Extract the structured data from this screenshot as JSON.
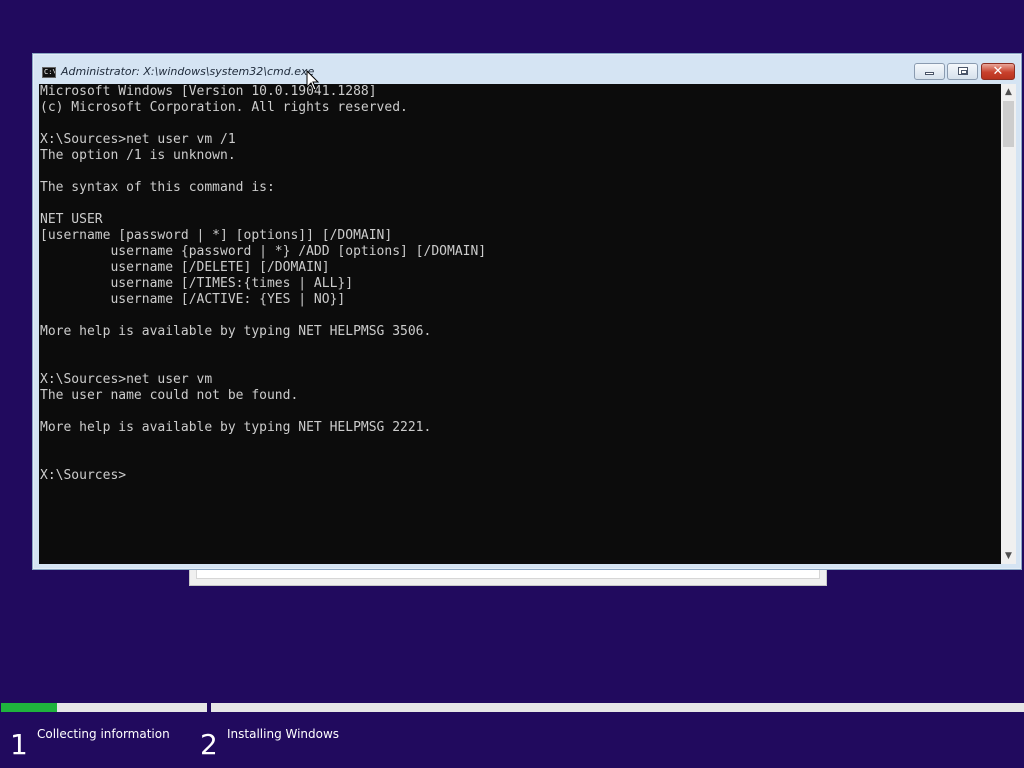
{
  "window": {
    "title": "Administrator: X:\\windows\\system32\\cmd.exe",
    "app_icon_text": "C:\\"
  },
  "console": {
    "lines": [
      "Microsoft Windows [Version 10.0.19041.1288]",
      "(c) Microsoft Corporation. All rights reserved.",
      "",
      "X:\\Sources>net user vm /1",
      "The option /1 is unknown.",
      "",
      "The syntax of this command is:",
      "",
      "NET USER",
      "[username [password | *] [options]] [/DOMAIN]",
      "         username {password | *} /ADD [options] [/DOMAIN]",
      "         username [/DELETE] [/DOMAIN]",
      "         username [/TIMES:{times | ALL}]",
      "         username [/ACTIVE: {YES | NO}]",
      "",
      "More help is available by typing NET HELPMSG 3506.",
      "",
      "",
      "X:\\Sources>net user vm",
      "The user name could not be found.",
      "",
      "More help is available by typing NET HELPMSG 2221.",
      "",
      "",
      "X:\\Sources>"
    ]
  },
  "setup_progress": {
    "steps": [
      {
        "number": "1",
        "label": "Collecting information",
        "progress_fraction": 0.27
      },
      {
        "number": "2",
        "label": "Installing Windows",
        "progress_fraction": 0
      }
    ],
    "accent_color": "#1fb33d"
  },
  "colors": {
    "desktop_background": "#210a5e",
    "console_background": "#0c0c0c",
    "console_text": "#cccccc"
  }
}
